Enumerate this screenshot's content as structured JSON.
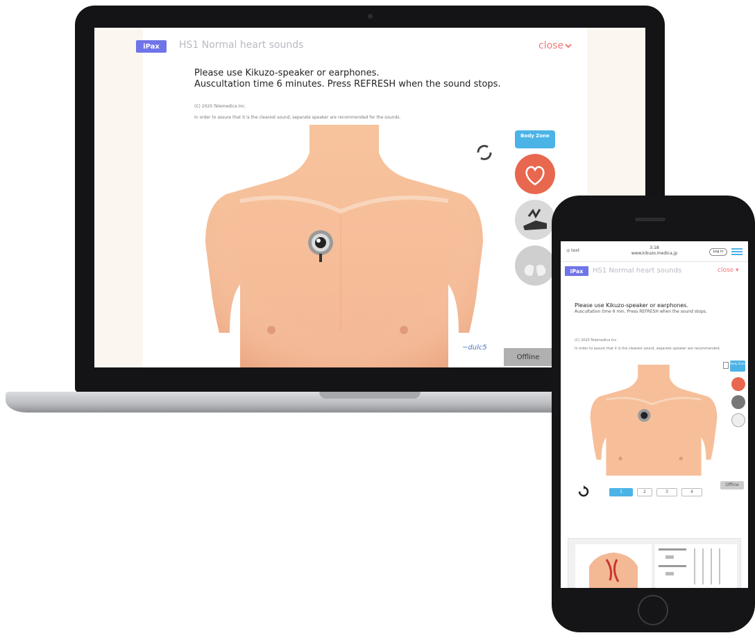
{
  "laptop": {
    "badge": "iPax",
    "title": "HS1 Normal heart sounds",
    "close_label": "close",
    "instruction_1": "Please use Kikuzo-speaker or earphones.",
    "instruction_2": "Auscultation time 6 minutes. Press REFRESH when the sound stops.",
    "copyright": "(C) 2020 Telemedica Inc.",
    "note": "In order to assure that it is the clearest sound, separate speaker are recommended for the sounds.",
    "body_zone_label": "Body Zone",
    "offline_label": "Offline",
    "colors": {
      "badge": "#6f74e8",
      "close": "#f07a7a",
      "accent": "#4cb3e6",
      "heart": "#e8674f"
    },
    "icons": [
      "refresh-icon",
      "heart-icon",
      "abdomen-icon",
      "lungs-icon",
      "stethoscope-icon"
    ]
  },
  "phone": {
    "status_left": "◎ text",
    "status_center_1": "3:18",
    "status_center_2": "www.kikuzo.medica.jp",
    "login_label": "Log in",
    "badge": "iPax",
    "title": "HS1 Normal heart sounds",
    "close_label": "close",
    "instruction_1": "Please use Kikuzo-speaker or earphones.",
    "instruction_2": "Auscultation time 6 min. Press REFRESH when the sound stops.",
    "copyright": "(C) 2020 Telemedica Inc.",
    "note": "In order to assure that it is the clearest sound, separate speaker are recommended.",
    "body_zone_label": "Body Zone",
    "offline_label": "Offline",
    "controls": [
      "1",
      "2",
      "3",
      "4"
    ]
  }
}
